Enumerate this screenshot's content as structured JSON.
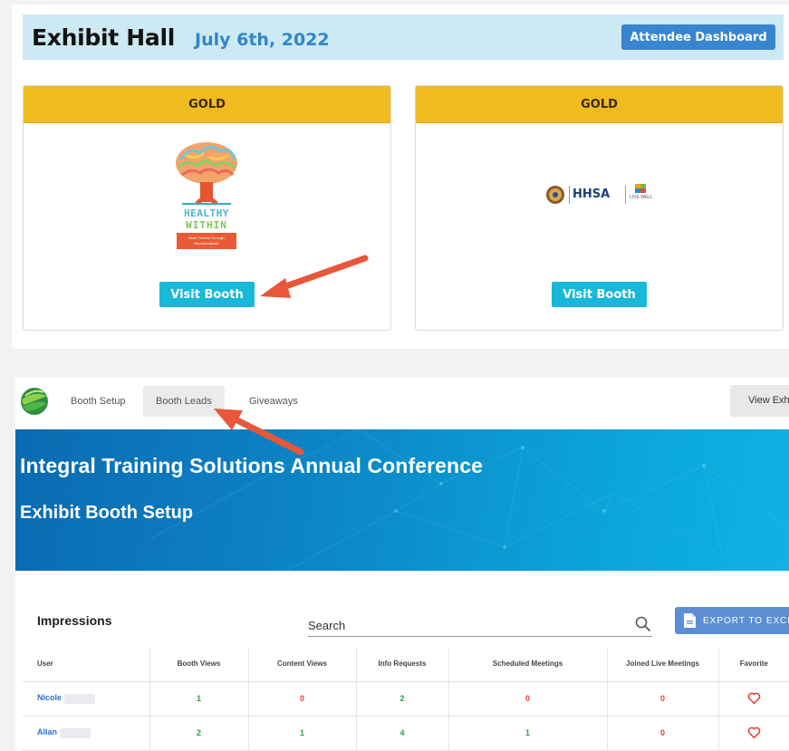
{
  "exhibit_hall": {
    "title": "Exhibit Hall",
    "date": "July 6th, 2022",
    "attendee_dashboard_label": "Attendee Dashboard",
    "booths": [
      {
        "tier": "GOLD",
        "logo_lines": [
          "HEALTHY",
          "WITHIN",
          "Brain Fitness Through Neurofeedback"
        ],
        "visit_label": "Visit Booth"
      },
      {
        "tier": "GOLD",
        "logo_lines": [
          "HHSA",
          "LIVE WELL"
        ],
        "visit_label": "Visit Booth"
      }
    ]
  },
  "booth_setup": {
    "nav": {
      "items": [
        "Booth Setup",
        "Booth Leads",
        "Giveaways"
      ],
      "active": "Booth Leads",
      "view_exhibit_label": "View Exhi"
    },
    "banner": {
      "title": "Integral Training Solutions Annual Conference",
      "subtitle": "Exhibit Booth Setup"
    },
    "impressions_label": "Impressions",
    "search": {
      "placeholder": "Search",
      "value": ""
    },
    "export_label": "EXPORT TO EXCEL",
    "table": {
      "columns": [
        "User",
        "Booth Views",
        "Content Views",
        "Info Requests",
        "Scheduled Meetings",
        "Joined Live Meetings",
        "Favorite"
      ],
      "rows": [
        {
          "user": "Nicole",
          "booth_views": "1",
          "content_views": "0",
          "info_requests": "2",
          "scheduled_meetings": "0",
          "joined_live_meetings": "0",
          "favorite": "heart-outline-icon"
        },
        {
          "user": "Allan",
          "booth_views": "2",
          "content_views": "1",
          "info_requests": "4",
          "scheduled_meetings": "1",
          "joined_live_meetings": "0",
          "favorite": "heart-outline-icon"
        }
      ]
    }
  },
  "colors": {
    "gold_tier": "#f0bb1f",
    "visit_button": "#18b9d8",
    "header_bg": "#cde9f3",
    "date_blue": "#2f86cc",
    "positive_green": "#2e9d47",
    "zero_red": "#e53935"
  }
}
